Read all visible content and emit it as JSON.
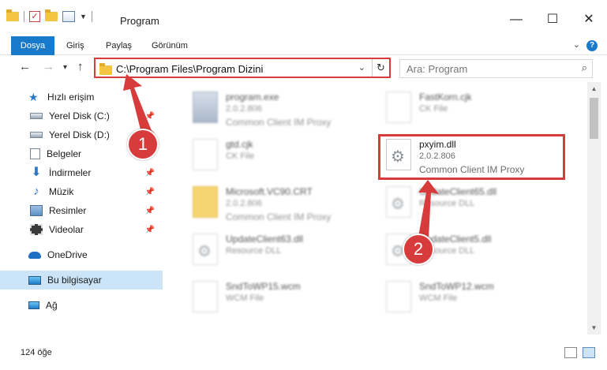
{
  "window": {
    "title": "Program",
    "controls": [
      "minimize-icon",
      "maximize-icon",
      "close-icon"
    ]
  },
  "ribbon": {
    "tabs": [
      "Dosya",
      "Giriş",
      "Paylaş",
      "Görünüm"
    ],
    "active_tab": "Dosya",
    "active_color": "#1979ca"
  },
  "nav": {
    "address": "C:\\Program Files\\Program Dizini",
    "search_placeholder": "Ara: Program"
  },
  "sidebar": {
    "items": [
      {
        "label": "Hızlı erişim",
        "icon": "star-icon"
      },
      {
        "label": "Yerel Disk (C:)",
        "icon": "drive-icon",
        "pinned": true
      },
      {
        "label": "Yerel Disk (D:)",
        "icon": "drive-icon",
        "pinned": true
      },
      {
        "label": "Belgeler",
        "icon": "documents-icon",
        "pinned": true
      },
      {
        "label": "İndirmeler",
        "icon": "downloads-icon",
        "pinned": true
      },
      {
        "label": "Müzik",
        "icon": "music-icon",
        "pinned": true
      },
      {
        "label": "Resimler",
        "icon": "pictures-icon",
        "pinned": true
      },
      {
        "label": "Videolar",
        "icon": "videos-icon",
        "pinned": true
      },
      {
        "label": "OneDrive",
        "icon": "cloud-icon"
      },
      {
        "label": "Bu bilgisayar",
        "icon": "computer-icon",
        "selected": true
      },
      {
        "label": "Ağ",
        "icon": "network-icon"
      }
    ]
  },
  "files": {
    "left": [
      {
        "name": "program.exe",
        "version": "2.0.2.806",
        "description": "Common Client IM Proxy",
        "icon": "exe-icon"
      },
      {
        "name": "gtd.cjk",
        "version": "",
        "description": "CK File",
        "icon": "document-icon"
      },
      {
        "name": "Microsoft.VC90.CRT",
        "version": "2.0.2.806",
        "description": "Common Client IM Proxy",
        "icon": "folder-icon"
      },
      {
        "name": "UpdateClient63.dll",
        "version": "",
        "description": "Resource DLL",
        "icon": "dll-icon"
      },
      {
        "name": "SndToWP15.wcm",
        "version": "",
        "description": "WCM File",
        "icon": "document-icon"
      }
    ],
    "right": [
      {
        "name": "FastKorn.cjk",
        "version": "",
        "description": "CK File",
        "icon": "document-icon"
      },
      {
        "name": "pxyim.dll",
        "version": "2.0.2.806",
        "description": "Common Client IM Proxy",
        "icon": "dll-icon",
        "highlighted": true
      },
      {
        "name": "UpdateClient65.dll",
        "version": "",
        "description": "Resource DLL",
        "icon": "dll-icon"
      },
      {
        "name": "UpdateClient5.dll",
        "version": "",
        "description": "Resource DLL",
        "icon": "dll-icon"
      },
      {
        "name": "SndToWP12.wcm",
        "version": "",
        "description": "WCM File",
        "icon": "document-icon"
      }
    ]
  },
  "status": {
    "item_count": "124 öğe"
  },
  "annotations": {
    "markers": [
      "1",
      "2"
    ],
    "color": "#d83b3b"
  }
}
